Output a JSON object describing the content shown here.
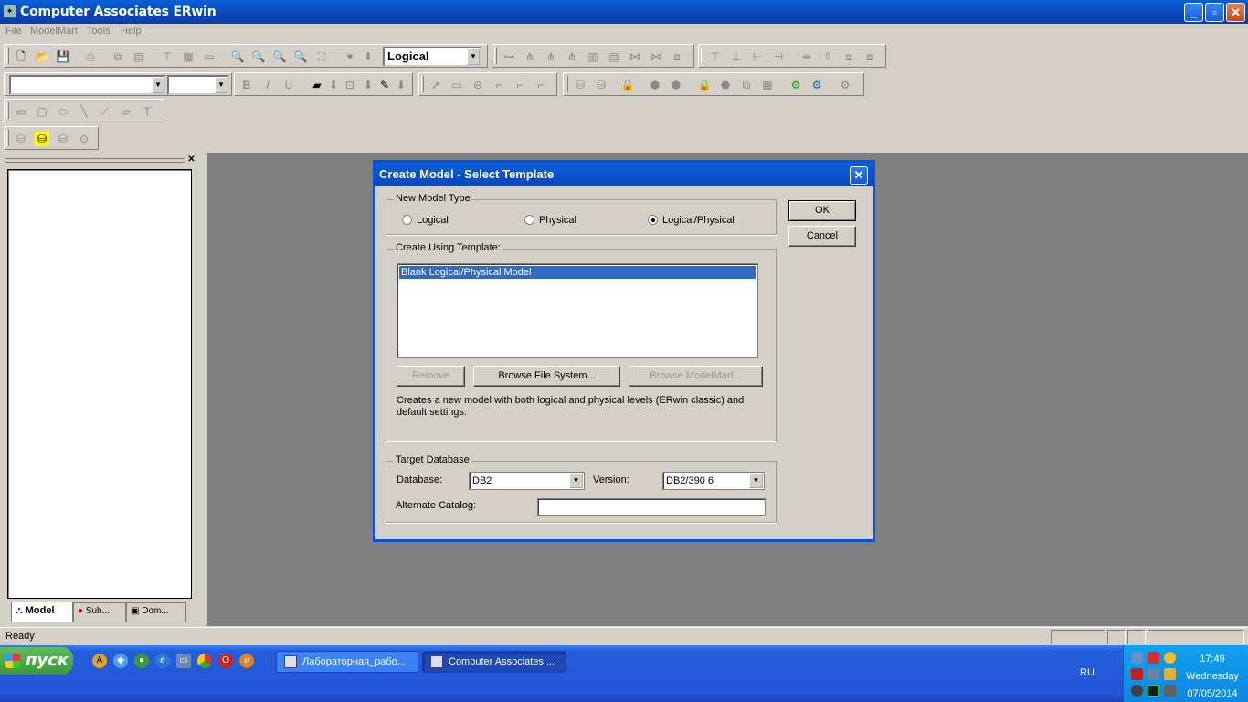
{
  "window": {
    "title": "Computer Associates ERwin",
    "minimize": "_",
    "restore": "▫",
    "close": "✕"
  },
  "menu": [
    "File",
    "ModelMart",
    "Tools",
    "Help"
  ],
  "toolbar": {
    "view_combo": "Logical",
    "font_combo": "",
    "size_combo": ""
  },
  "left_panel": {
    "close": "✕",
    "tabs": [
      "Model",
      "Sub...",
      "Dom..."
    ]
  },
  "dialog": {
    "title": "Create Model - Select Template",
    "close": "✕",
    "new_model_type": {
      "label": "New Model Type",
      "options": [
        "Logical",
        "Physical",
        "Logical/Physical"
      ],
      "selected": "Logical/Physical"
    },
    "ok": "OK",
    "cancel": "Cancel",
    "template": {
      "label": "Create Using Template:",
      "items": [
        "Blank Logical/Physical Model"
      ],
      "remove": "Remove",
      "browse_fs": "Browse File System...",
      "browse_mm": "Browse ModelMart...",
      "description": "Creates a new model with both logical and physical levels (ERwin classic) and default settings."
    },
    "target": {
      "label": "Target Database",
      "database_label": "Database:",
      "database_value": "DB2",
      "version_label": "Version:",
      "version_value": "DB2/390 6",
      "alt_catalog_label": "Alternate Catalog:",
      "alt_catalog_value": ""
    }
  },
  "status": {
    "text": "Ready"
  },
  "taskbar": {
    "start": "пуск",
    "tasks": [
      "Лабораторная_рабо...",
      "Computer Associates ..."
    ],
    "lang": "RU",
    "time": "17:49",
    "day": "Wednesday",
    "date": "07/05/2014"
  },
  "colors": {
    "accent": "#0a5fd8",
    "selection": "#316ac5",
    "workspace": "#808080",
    "taskbar": "#245edb"
  }
}
